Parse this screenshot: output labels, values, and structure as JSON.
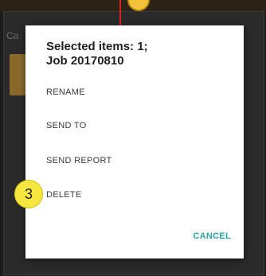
{
  "dialog": {
    "title_line1": "Selected items: 1;",
    "title_line2": "Job 20170810",
    "menu": {
      "rename": "RENAME",
      "send_to": "SEND TO",
      "send_report": "SEND REPORT",
      "delete": "DELETE"
    },
    "cancel_label": "CANCEL"
  },
  "background": {
    "label": "Ca"
  },
  "annotations": {
    "step_number": "3"
  },
  "colors": {
    "accent": "#2aa6a0",
    "arrow": "#e0201e",
    "badge": "#f5e640"
  }
}
